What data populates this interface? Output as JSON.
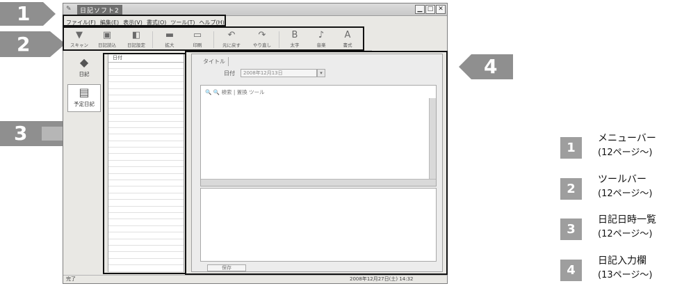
{
  "app": {
    "title": "日記ソフト2",
    "menu": [
      "ファイル(F)",
      "編集(E)",
      "表示(V)",
      "書式(O)",
      "ツール(T)",
      "ヘルプ(H)"
    ],
    "toolbar": [
      {
        "icon": "scanner-icon",
        "glyph": "▼",
        "label": "スキャン"
      },
      {
        "icon": "book-icon",
        "glyph": "▣",
        "label": "日記読込"
      },
      {
        "icon": "settings-icon",
        "glyph": "◧",
        "label": "日記設定"
      },
      {
        "icon": "zoom-icon",
        "glyph": "▬",
        "label": "拡大"
      },
      {
        "icon": "print-icon",
        "glyph": "▭",
        "label": "印刷"
      },
      {
        "icon": "undo-icon",
        "glyph": "↶",
        "label": "元に戻す"
      },
      {
        "icon": "redo-icon",
        "glyph": "↷",
        "label": "やり直し"
      },
      {
        "icon": "bold-icon",
        "glyph": "B",
        "label": "太字"
      },
      {
        "icon": "music-icon",
        "glyph": "♪",
        "label": "音楽"
      },
      {
        "icon": "font-icon",
        "glyph": "A",
        "label": "書式"
      }
    ],
    "nav": [
      {
        "icon": "diary-icon",
        "glyph": "◆",
        "label": "日記"
      },
      {
        "icon": "calendar-icon",
        "glyph": "▤",
        "label": "予定日記"
      }
    ],
    "list_header": "日付",
    "input": {
      "tab": "タイトル",
      "date_label": "日付",
      "date_value": "2008年12月13日",
      "editor_tools": "🔍 🔍 検索 | 置換 ツール",
      "footer_tab": "保存"
    },
    "status_left": "完了",
    "status_right": "2008年12月27日(土) 14:32"
  },
  "callouts": [
    {
      "num": "1"
    },
    {
      "num": "2"
    },
    {
      "num": "3"
    },
    {
      "num": "4"
    }
  ],
  "legend": [
    {
      "num": "1",
      "title": "メニューバー",
      "page": "(12ページ〜)"
    },
    {
      "num": "2",
      "title": "ツールバー",
      "page": "(12ページ〜)"
    },
    {
      "num": "3",
      "title": "日記日時一覧",
      "page": "(12ページ〜)"
    },
    {
      "num": "4",
      "title": "日記入力欄",
      "page": "(13ページ〜)"
    }
  ]
}
